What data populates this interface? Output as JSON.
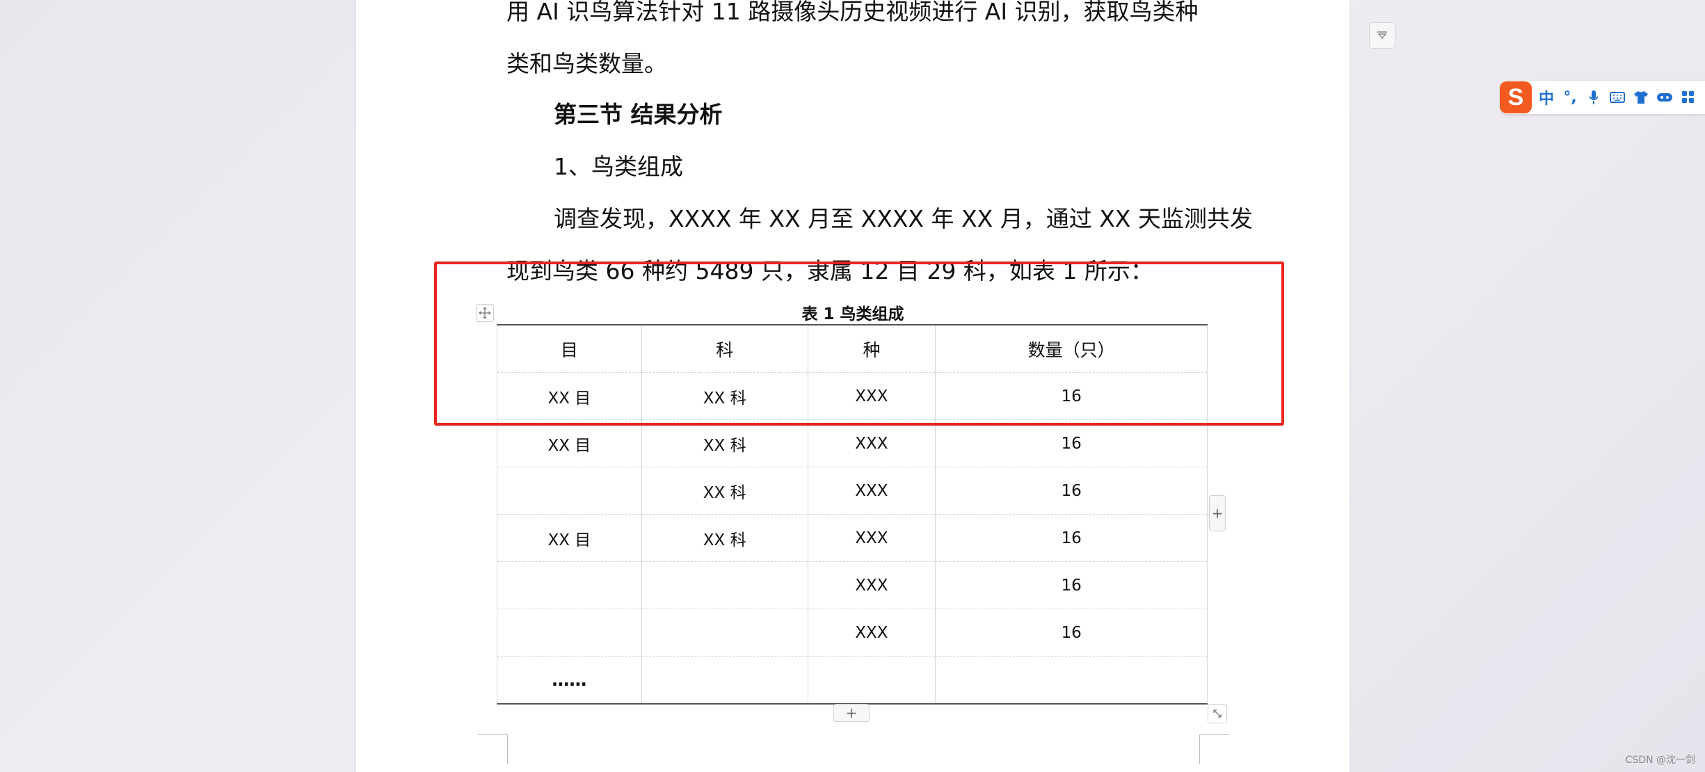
{
  "document": {
    "paragraphs": {
      "line1": "用 AI 识鸟算法针对 11 路摄像头历史视频进行 AI 识别，获取鸟类种",
      "line2": "类和鸟类数量。",
      "section_heading": "第三节  结果分析",
      "subheading": "1、鸟类组成",
      "survey_line1": "调查发现，XXXX 年 XX 月至 XXXX 年 XX 月，通过 XX 天监测共发",
      "survey_line2": "现到鸟类 66 种约 5489 只，隶属 12 目 29 科，如表 1 所示："
    },
    "table": {
      "caption": "表 1  鸟类组成",
      "headers": [
        "目",
        "科",
        "种",
        "数量（只）"
      ],
      "rows": [
        [
          "XX 目",
          "XX 科",
          "XXX",
          "16"
        ],
        [
          "XX 目",
          "XX 科",
          "XXX",
          "16"
        ],
        [
          "",
          "XX 科",
          "XXX",
          "16"
        ],
        [
          "XX 目",
          "XX 科",
          "XXX",
          "16"
        ],
        [
          "",
          "",
          "XXX",
          "16"
        ],
        [
          "",
          "",
          "XXX",
          "16"
        ],
        [
          "……",
          "",
          "",
          ""
        ]
      ],
      "add_column_label": "+",
      "add_row_label": "+"
    }
  },
  "ime_toolbar": {
    "logo": "S",
    "items": [
      "中",
      "°,",
      "mic-icon",
      "keyboard-icon",
      "shirt-icon",
      "gamepad-icon",
      "grid-icon"
    ],
    "mode_label": "中",
    "punct_label": "°,"
  },
  "watermark": "CSDN @沈一剑",
  "colors": {
    "highlight": "#e8261f",
    "ime_accent": "#1f6fd1",
    "ime_logo": "#f25a1f"
  }
}
